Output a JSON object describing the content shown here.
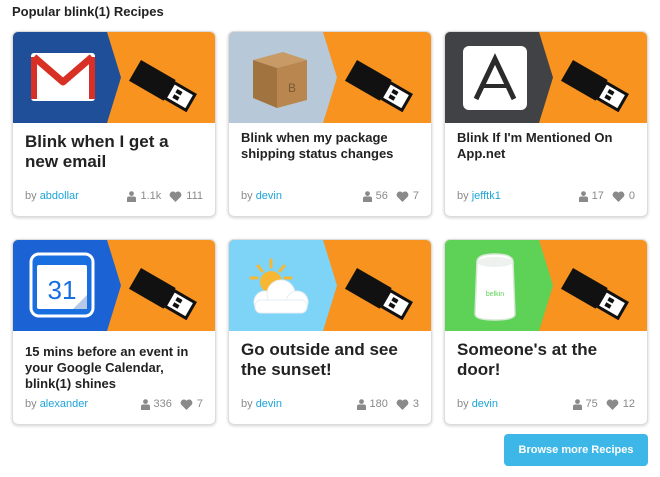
{
  "page": {
    "title": "Popular blink(1) Recipes"
  },
  "colors": {
    "arrow_orange": "#f7931e",
    "author_link": "#1ea3d7",
    "button": "#3cb7e8",
    "gmail_bg": "#1f4f99",
    "package_bg": "#b7c9d8",
    "appnet_bg": "#414245",
    "calendar_bg": "#1b63d4",
    "sunset_bg": "#7ed4f7",
    "belkin_bg": "#5dd257"
  },
  "recipes": [
    {
      "icon": "gmail-icon",
      "title": "Blink when I get a new email",
      "by": "by",
      "author": "abdollar",
      "views": "1.1k",
      "likes": "111"
    },
    {
      "icon": "package-icon",
      "title": "Blink when my package shipping status changes",
      "by": "by",
      "author": "devin",
      "views": "56",
      "likes": "7"
    },
    {
      "icon": "appnet-icon",
      "title": "Blink If I'm Mentioned On App.net",
      "by": "by",
      "author": "jefftk1",
      "views": "17",
      "likes": "0"
    },
    {
      "icon": "calendar-icon",
      "calendar_day": "31",
      "title": "15 mins before an event in your Google Calendar, blink(1) shines",
      "by": "by",
      "author": "alexander",
      "views": "336",
      "likes": "7"
    },
    {
      "icon": "sunset-icon",
      "title": "Go outside and see the sunset!",
      "by": "by",
      "author": "devin",
      "views": "180",
      "likes": "3"
    },
    {
      "icon": "belkin-icon",
      "belkin_text": "belkin",
      "title": "Someone's at the door!",
      "by": "by",
      "author": "devin",
      "views": "75",
      "likes": "12"
    }
  ],
  "browse_button": {
    "label": "Browse more Recipes"
  }
}
